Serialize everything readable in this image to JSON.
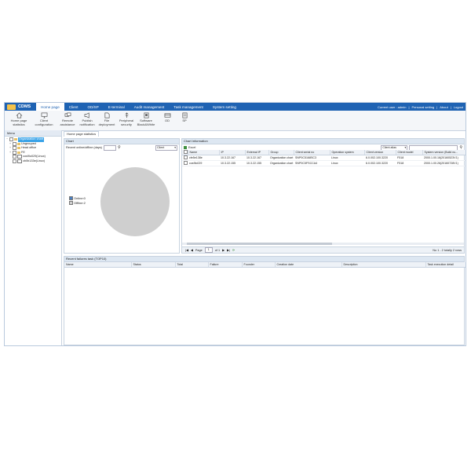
{
  "app": {
    "logo": "CDMS",
    "menu": [
      "Home page",
      "Client",
      "OD/SP",
      "E-terminal",
      "Audit management",
      "Task management",
      "System setting"
    ],
    "user": {
      "current_user": "Current user : admin",
      "personal": "Personal setting",
      "about": "About",
      "logout": "Logout"
    }
  },
  "toolbar": [
    {
      "label1": "Home page",
      "label2": "statistics",
      "icon": "home-icon"
    },
    {
      "label1": "Client",
      "label2": "configuration",
      "icon": "monitor-icon"
    },
    {
      "label1": "Remote",
      "label2": "assistance",
      "icon": "remote-icon"
    },
    {
      "label1": "Publish",
      "label2": "notification",
      "icon": "megaphone-icon"
    },
    {
      "label1": "File",
      "label2": "deployment",
      "icon": "file-icon"
    },
    {
      "label1": "Peripheral",
      "label2": "security",
      "icon": "usb-icon"
    },
    {
      "label1": "Software",
      "label2": "Black&White",
      "icon": "software-icon"
    },
    {
      "label1": "OD",
      "label2": "",
      "icon": "od-icon"
    },
    {
      "label1": "SP",
      "label2": "",
      "icon": "sp-icon"
    }
  ],
  "sidebar": {
    "header": "Menu",
    "tree": [
      {
        "label": "Organization chart",
        "level": 0,
        "selected": true
      },
      {
        "label": "Ungrouped",
        "level": 1,
        "selected": false
      },
      {
        "label": "Head office",
        "level": 1,
        "selected": false
      },
      {
        "label": "FE",
        "level": 1,
        "selected": false
      },
      {
        "label": "cos9lo029(Linux)",
        "level": 1,
        "selected": false
      },
      {
        "label": "cb0b133e(Linux)",
        "level": 1,
        "selected": false
      }
    ]
  },
  "main": {
    "tab": "Home page statistics",
    "chart_panel": {
      "title": "Chart",
      "recent_label": "Recent online/offline (days)",
      "select_value": "Client",
      "legend": [
        {
          "label": "Online:0",
          "color": "#4a7fc1"
        },
        {
          "label": "Offline:2",
          "color": "#cfcfcf"
        }
      ]
    },
    "info_panel": {
      "title": "Chart information",
      "export": "Excel",
      "filter_value": "Client alias",
      "columns": [
        "Name",
        "IP",
        "External IP",
        "Group",
        "Client serial no",
        "Operation system",
        "Client version",
        "Client model",
        "System version (Build nu..."
      ],
      "rows": [
        [
          "cfe5e138e",
          "10.3.22.167",
          "10.3.22.167",
          "Organization chart",
          "SNP0C5168SC3",
          "Linux",
          "6.0.002.100.3220",
          "F518",
          "2000.1.00.16(20160523V1)"
        ],
        [
          "cos9lo029",
          "10.3.22.155",
          "10.3.22.155",
          "Organization chart",
          "SNP0C5FSCCA4",
          "Linux",
          "6.0.002.100.3220",
          "F518",
          "2000.1.00.26(20160728V1)"
        ]
      ],
      "pager": {
        "page_label": "Page",
        "page_value": "1",
        "of_label": "of 1",
        "summary": "No 1 - 2 totally 2 rows"
      }
    },
    "failures_panel": {
      "title": "Recent failures task (TOP10)",
      "columns": [
        "Name",
        "Status",
        "Total",
        "Failure",
        "Founder",
        "Creation date",
        "Description",
        "Task execution detail"
      ]
    }
  },
  "chart_data": {
    "type": "pie",
    "categories": [
      "Online",
      "Offline"
    ],
    "values": [
      0,
      2
    ],
    "colors": [
      "#4a7fc1",
      "#cfcfcf"
    ]
  }
}
